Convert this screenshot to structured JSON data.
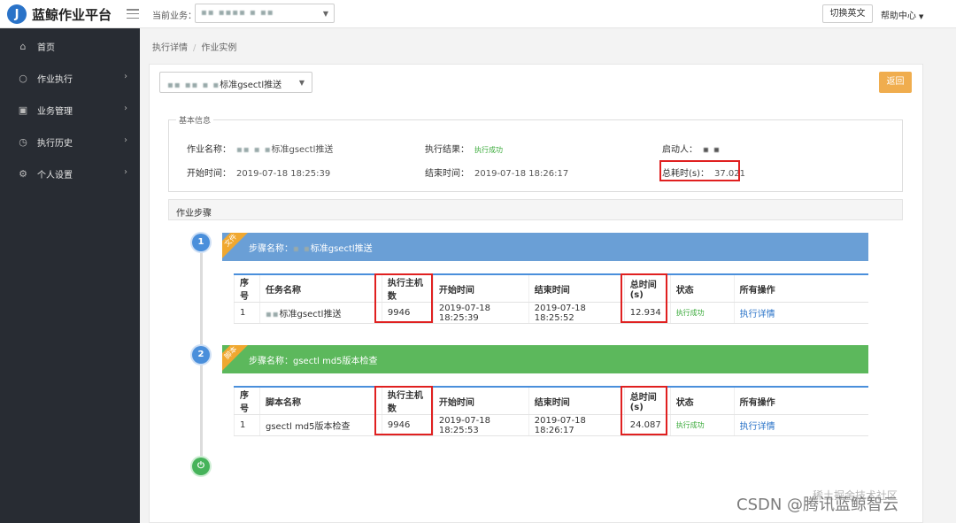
{
  "header": {
    "logo_letter": "J",
    "app_title": "蓝鲸作业平台",
    "biz_label": "当前业务：",
    "biz_value": "▪︎▪ ▪▪▪▪ ▪ ▪▪",
    "lang_button": "切换英文",
    "help_label": "帮助中心"
  },
  "sidebar": {
    "items": [
      {
        "label": "首页",
        "icon": "home-icon",
        "glyph": "⌂",
        "has_arrow": false
      },
      {
        "label": "作业执行",
        "icon": "circle-icon",
        "glyph": "○",
        "has_arrow": true
      },
      {
        "label": "业务管理",
        "icon": "briefcase-icon",
        "glyph": "▣",
        "has_arrow": true
      },
      {
        "label": "执行历史",
        "icon": "clock-icon",
        "glyph": "◷",
        "has_arrow": true
      },
      {
        "label": "个人设置",
        "icon": "gear-icon",
        "glyph": "⚙",
        "has_arrow": true
      }
    ]
  },
  "breadcrumb": {
    "item1": "执行详情",
    "item2": "作业实例"
  },
  "toolbar": {
    "step_select_prefix": "▪▪ ▪▪ ▪ ▪",
    "step_select_value": "标准gsectl推送",
    "back_button": "返回"
  },
  "basic_info": {
    "legend": "基本信息",
    "job_name_label": "作业名称：",
    "job_name_prefix": "▪▪ ▪ ▪",
    "job_name_value": "标准gsectl推送",
    "result_label": "执行结果：",
    "result_value": "执行成功",
    "starter_label": "启动人：",
    "starter_value": "▪ ▪",
    "start_label": "开始时间：",
    "start_value": "2019-07-18 18:25:39",
    "end_label": "结束时间：",
    "end_value": "2019-07-18 18:26:17",
    "total_label": "总耗时(s)：",
    "total_value": "37.021"
  },
  "steps_section": {
    "title": "作业步骤"
  },
  "steps": [
    {
      "index": "1",
      "corner": "文件",
      "title_prefix": "步骤名称：",
      "title_redacted": "▪ ▪",
      "title_value": "标准gsectl推送",
      "headers": [
        "序号",
        "任务名称",
        "执行主机数",
        "开始时间",
        "结束时间",
        "总时间(s)",
        "状态",
        "所有操作"
      ],
      "row": {
        "seq": "1",
        "name_redacted": "▪▪",
        "name": "标准gsectl推送",
        "hosts": "9946",
        "start": "2019-07-18 18:25:39",
        "end": "2019-07-18 18:25:52",
        "total": "12.934",
        "status": "执行成功",
        "action": "执行详情"
      }
    },
    {
      "index": "2",
      "corner": "脚本",
      "title_prefix": "步骤名称：",
      "title_value": "gsectl md5版本检查",
      "headers": [
        "序号",
        "脚本名称",
        "执行主机数",
        "开始时间",
        "结束时间",
        "总时间(s)",
        "状态",
        "所有操作"
      ],
      "row": {
        "seq": "1",
        "name": "gsectl md5版本检查",
        "hosts": "9946",
        "start": "2019-07-18 18:25:53",
        "end": "2019-07-18 18:26:17",
        "total": "24.087",
        "status": "执行成功",
        "action": "执行详情"
      }
    }
  ],
  "watermark": {
    "text": "CSDN @腾讯蓝鲸智云",
    "faint": "稀土掘金技术社区"
  }
}
